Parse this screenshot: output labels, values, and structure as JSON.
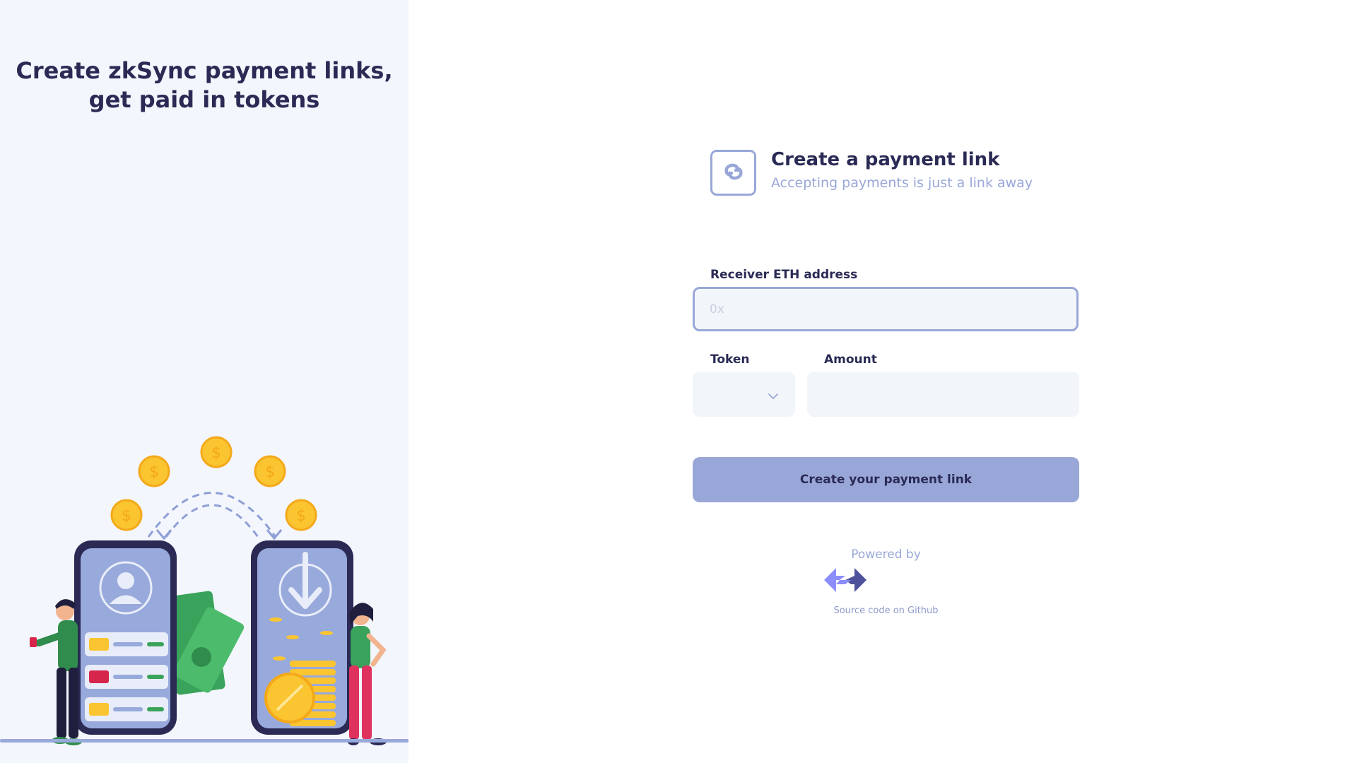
{
  "hero": {
    "title_line1": "Create zkSync payment links,",
    "title_line2": "get paid in tokens"
  },
  "header": {
    "title": "Create a payment link",
    "subtitle": "Accepting payments is just a link away",
    "logo_icon": "chain-link-icon"
  },
  "form": {
    "address_label": "Receiver ETH address",
    "address_placeholder": "0x",
    "address_value": "",
    "token_label": "Token",
    "token_value": "",
    "amount_label": "Amount",
    "amount_value": "",
    "submit_label": "Create your payment link"
  },
  "footer": {
    "powered_by": "Powered by",
    "brand_icon": "zksync-logo-icon",
    "github_link": "Source code on Github"
  },
  "colors": {
    "accent": "#99a7d8",
    "text": "#2a2a55",
    "input_bg": "#f2f5f9",
    "panel_bg": "#f3f6fc",
    "coin": "#fbc531",
    "money": "#3aa35b"
  }
}
